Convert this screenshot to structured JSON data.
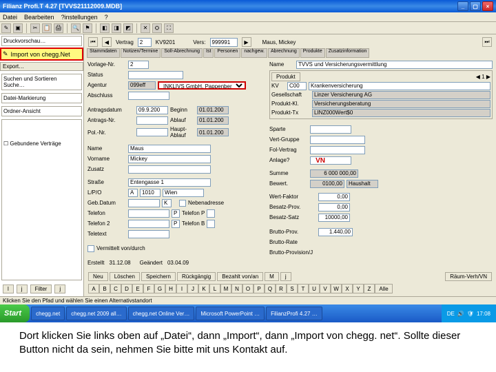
{
  "titlebar": {
    "title": "Filianz Profi.T 4.27   [TVVS21112009.MDB]"
  },
  "menubar": {
    "items": [
      "Datei",
      "Bearbeiten",
      "?instellungen",
      "?"
    ]
  },
  "sidebar": {
    "open_item": "Druckvorschau…",
    "highlight_btn": "Import von chegg.Net",
    "export_btn": "Export…",
    "group1": [
      "Suchen und Sortieren",
      "Suche…"
    ],
    "group2": [
      "Datei-Markierung"
    ],
    "group3": [
      "Ordner-Ansicht"
    ],
    "tree_item": "Gebundene Verträge",
    "buttons": [
      "l",
      "j",
      "Filter",
      "j"
    ]
  },
  "nav": {
    "vertrag_lbl": "Vertrag",
    "vertrag_val": "2",
    "kv_lbl": "KV9201",
    "vers_lbl": "Vers:",
    "vers_val": "999991",
    "person_lbl": "Maus, Mickey"
  },
  "tabs": [
    "Stammdaten",
    "Notizen/Termine",
    "Soll-Abrechnung",
    "Ist",
    "Personen",
    "nachgew.",
    "Abrechnung",
    "Produkte",
    "Zusatzinformation"
  ],
  "form": {
    "vorlage_lbl": "Vorlage-Nr.",
    "vorlage_val": "2",
    "status_lbl": "Status",
    "agentur_lbl": "Agentur",
    "agentur_val": "099eff",
    "agentur_dd": "INKLIVS GmbH, Pappenbergstr.",
    "abschluss_lbl": "Abschluss",
    "antragsdatum_lbl": "Antragsdatum",
    "antragsdatum_val": "09.9.200",
    "antragsnr_lbl": "Antrags-Nr.",
    "polnr_lbl": "Pol.-Nr.",
    "beginn_lbl": "Beginn",
    "beginn_val": "01.01.200",
    "ablauf_lbl": "Ablauf",
    "ablauf_val": "01.01.200",
    "hauptablauf_lbl": "Haupt-Ablauf",
    "hauptablauf_val": "01.01.200",
    "name_lbl": "Name",
    "name_val": "Maus",
    "vorname_lbl": "Vorname",
    "vorname_val": "Mickey",
    "zusatz_lbl": "Zusatz",
    "strasse_lbl": "Straße",
    "strasse_val": "Entengasse 1",
    "lpo_lbl": "L/P/O",
    "lpo_a": "A",
    "lpo_b": "1010",
    "lpo_c": "Wien",
    "geb_lbl": "Geb.Datum",
    "geb_val": "K",
    "neben_lbl": "Nebenadresse",
    "tel1_lbl": "Telefon",
    "tel1_r": "P",
    "tel1_v": "Telefon P",
    "tel2_lbl": "Telefon 2",
    "tel2_r": "P",
    "tel2_v": "Telefon B",
    "tel3_lbl": "Teletext",
    "vermittelt_lbl": "Vermittelt von/durch",
    "erstellt_lbl": "Erstellt",
    "erstellt_val": "31.12.08",
    "geaendert_lbl": "Geändert",
    "geaendert_val": "03.04.09"
  },
  "right": {
    "name_line": "TVVS und Versicherungsvermittlung",
    "produkt_btn": "Produkt",
    "kv_l": "KV",
    "kv_c": "C00",
    "kv_t": "Krankenversicherung",
    "ges_l": "Gesellschaft",
    "ges_v": "Linzer Versicherung AG",
    "prodkl_l": "Produkt-Kl.",
    "prodkl_v": "Versicherungsberatung",
    "prodtx_l": "Produkt-Tx",
    "prodtx_v": "LINZ000Wert$0",
    "sparte_lbl": "Sparte",
    "vertgruppe_l": "Vert-Gruppe",
    "folvertrag_l": "Fol-Vertrag",
    "anlage_l": "Anlage?",
    "summe_l": "Summe",
    "summe_v": "6 000 000,00",
    "bewert_l": "Bewert.",
    "bewert_v": "0100,00",
    "bewert_u": "Haushalt",
    "wertfaktor_l": "Wert-Faktor",
    "wertfaktor_v": "0,00",
    "besprov_l": "Besatz-Prov.",
    "besprov_v": "0,00",
    "bessatz_l": "Besatz-Satz",
    "bessatz_v": "10000,00",
    "brprov_l": "Brutto-Prov.",
    "brrate_l": "Brutto-Rate",
    "brpr3_l": "Brutto-Provision/J",
    "brprov_v": "1.440,00"
  },
  "vn_label": "VN",
  "buttons": {
    "neu": "Neu",
    "loeschen": "Löschen",
    "speichern": "Speichern",
    "rueck": "Rückgängig",
    "bezahlt": "Bezahlt von/an",
    "m": "M",
    "j": "j",
    "raum": "Räum-Verh/VN"
  },
  "alpha": [
    "A",
    "B",
    "C",
    "D",
    "E",
    "F",
    "G",
    "H",
    "I",
    "J",
    "K",
    "L",
    "M",
    "N",
    "O",
    "P",
    "Q",
    "R",
    "S",
    "T",
    "U",
    "V",
    "W",
    "X",
    "Y",
    "Z",
    "Alle"
  ],
  "statusbar": "Klicken Sie den Pfad und wählen Sie einen Alternativstandort",
  "taskbar": {
    "start": "Start",
    "items": [
      "chegg.net",
      "chegg.net  2009   all…",
      "chegg.net Online Ver…",
      "Microsoft PowerPoint …",
      "FilianzProfi  4.27 …"
    ],
    "lang": "DE",
    "time": "17:08"
  },
  "caption": "Dort klicken Sie links oben auf „Datei“, dann „Import“, dann „Import von chegg. net“. Sollte dieser Button nicht da sein, nehmen Sie bitte mit uns Kontakt auf."
}
